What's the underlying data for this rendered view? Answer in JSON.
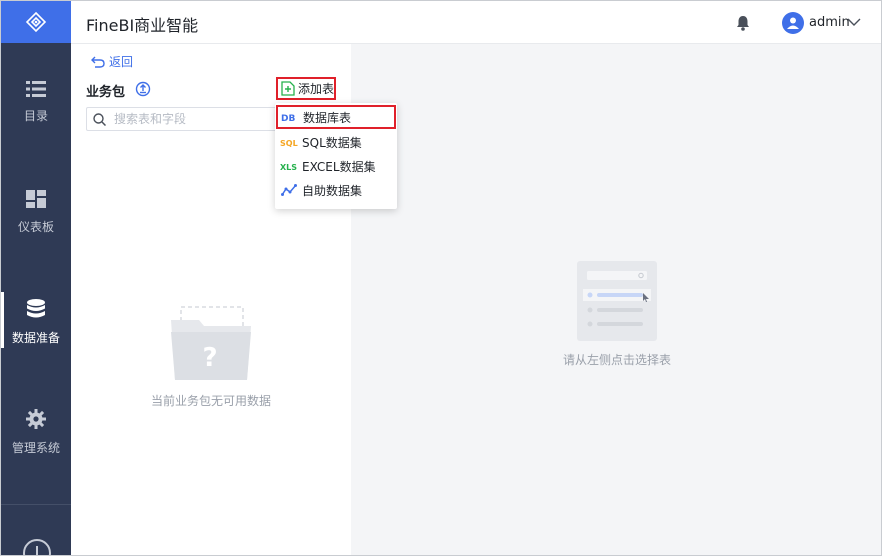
{
  "app": {
    "title": "FineBI商业智能"
  },
  "user": {
    "name": "admin"
  },
  "sidebar": {
    "items": [
      {
        "label": "目录",
        "icon": "list-icon"
      },
      {
        "label": "仪表板",
        "icon": "dashboard-icon"
      },
      {
        "label": "数据准备",
        "icon": "database-icon",
        "active": true
      },
      {
        "label": "管理系统",
        "icon": "gear-icon"
      }
    ]
  },
  "left_panel": {
    "back_label": "返回",
    "package_title": "业务包",
    "add_table_label": "添加表",
    "search": {
      "placeholder": "搜索表和字段",
      "value": ""
    },
    "empty_text": "当前业务包无可用数据"
  },
  "dropdown": {
    "items": [
      {
        "label": "数据库表",
        "icon": "db-icon",
        "highlighted": true
      },
      {
        "label": "SQL数据集",
        "icon": "sql-icon"
      },
      {
        "label": "EXCEL数据集",
        "icon": "excel-icon"
      },
      {
        "label": "自助数据集",
        "icon": "self-service-icon"
      }
    ]
  },
  "right_panel": {
    "hint": "请从左侧点击选择表"
  },
  "colors": {
    "brand": "#3f6fe8",
    "sidebar": "#2f3a55",
    "highlight_border": "#e0202a",
    "add_table_green": "#26b14d"
  }
}
